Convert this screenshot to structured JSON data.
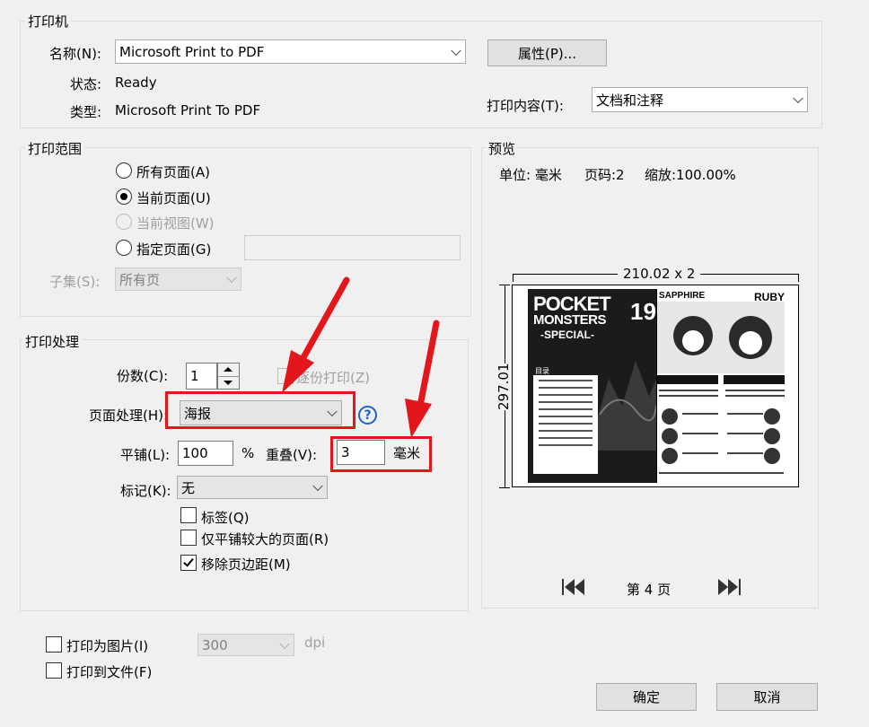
{
  "printer": {
    "legend": "打印机",
    "name_label": "名称(N):",
    "name_value": "Microsoft Print to PDF",
    "properties_button": "属性(P)...",
    "status_label": "状态:",
    "status_value": "Ready",
    "type_label": "类型:",
    "type_value": "Microsoft Print To PDF",
    "content_label": "打印内容(T):",
    "content_value": "文档和注释"
  },
  "range": {
    "legend": "打印范围",
    "options": [
      {
        "label": "所有页面(A)",
        "selected": false,
        "enabled": true
      },
      {
        "label": "当前页面(U)",
        "selected": true,
        "enabled": true
      },
      {
        "label": "当前视图(W)",
        "selected": false,
        "enabled": false
      },
      {
        "label": "指定页面(G)",
        "selected": false,
        "enabled": true
      }
    ],
    "pages_value": "",
    "subset_label": "子集(S):",
    "subset_value": "所有页"
  },
  "handling": {
    "legend": "打印处理",
    "copies_label": "份数(C):",
    "copies_value": "1",
    "collate_label": "逐份打印(Z)",
    "page_handling_label": "页面处理(H):",
    "page_handling_value": "海报",
    "help_glyph": "?",
    "tile_label": "平铺(L):",
    "tile_value": "100",
    "tile_unit": "%",
    "overlap_label": "重叠(V):",
    "overlap_value": "3",
    "overlap_unit": "毫米",
    "marks_label": "标记(K):",
    "marks_value": "无",
    "checkboxes": [
      {
        "label": "标签(Q)",
        "checked": false
      },
      {
        "label": "仅平铺较大的页面(R)",
        "checked": false
      },
      {
        "label": "移除页边距(M)",
        "checked": true
      }
    ]
  },
  "preview": {
    "legend": "预览",
    "unit_text": "单位: 毫米",
    "page_text": "页码:2",
    "zoom_text": "缩放:100.00%",
    "width_dim": "210.02 x 2",
    "height_dim": "297.01",
    "page_nav": "第 4 页",
    "cover_title_1": "POCKET",
    "cover_title_2": "MONSTERS",
    "cover_title_3": "-SPECIAL-",
    "cover_number": "19",
    "toc_title": "目录",
    "right_title_1": "SAPPHIRE",
    "right_title_2": "RUBY"
  },
  "bottom": {
    "print_as_image_label": "打印为图片(I)",
    "dpi_value": "300",
    "dpi_unit": "dpi",
    "print_to_file_label": "打印到文件(F)",
    "ok_button": "确定",
    "cancel_button": "取消"
  },
  "colors": {
    "annotation_red": "#e2161b",
    "help_blue": "#1e64c8"
  }
}
